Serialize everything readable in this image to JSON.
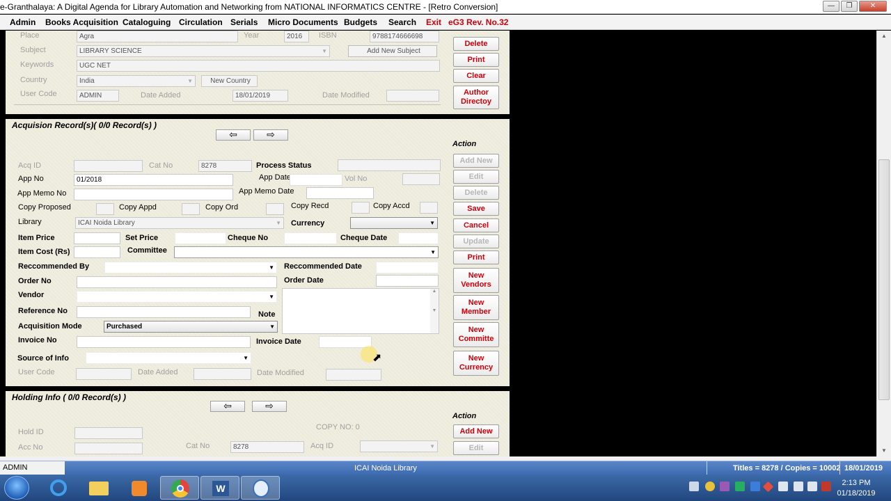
{
  "window": {
    "title": "e-Granthalaya: A Digital Agenda for Library Automation and Networking from NATIONAL INFORMATICS CENTRE - [Retro Conversion]"
  },
  "menu": [
    "Admin",
    "Books Acquisition",
    "Cataloguing",
    "Circulation",
    "Serials",
    "Micro Documents",
    "Budgets",
    "Search",
    "Exit"
  ],
  "menu_version": "eG3 Rev. No.32",
  "top": {
    "place_label": "Place",
    "place_value": "Agra",
    "year_label": "Year",
    "year_value": "2016",
    "isbn_label": "ISBN",
    "isbn_value": "9788174666698",
    "subject_label": "Subject",
    "subject_value": "LIBRARY SCIENCE",
    "add_subject_label": "Add New Subject",
    "keywords_label": "Keywords",
    "keywords_value": "UGC NET",
    "country_label": "Country",
    "country_value": "India",
    "new_country_label": "New Country",
    "user_code_label": "User Code",
    "user_code_value": "ADMIN",
    "date_added_label": "Date Added",
    "date_added_value": "18/01/2019",
    "date_modified_label": "Date Modified",
    "buttons": {
      "delete": "Delete",
      "print": "Print",
      "clear": "Clear",
      "author_line1": "Author",
      "author_line2": "Directoy"
    }
  },
  "acq": {
    "header": "Acquision Record(s)( 0/0 Record(s) )",
    "action_label": "Action",
    "acq_id_label": "Acq ID",
    "cat_no_label": "Cat No",
    "cat_no_value": "8278",
    "process_status_label": "Process Status",
    "app_no_label": "App No",
    "app_no_value": "01/2018",
    "app_date_label": "App Date",
    "vol_no_label": "Vol No",
    "app_memo_no_label": "App Memo No",
    "app_memo_date_label": "App Memo Date",
    "copy_proposed_label": "Copy Proposed",
    "copy_appd_label": "Copy Appd",
    "copy_ord_label": "Copy Ord",
    "copy_recd_label": "Copy Recd",
    "copy_accd_label": "Copy Accd",
    "library_label": "Library",
    "library_value": "ICAI Noida Library",
    "currency_label": "Currency",
    "item_price_label": "Item Price",
    "set_price_label": "Set Price",
    "cheque_no_label": "Cheque No",
    "cheque_date_label": "Cheque Date",
    "item_cost_label": "Item Cost (Rs)",
    "committee_label": "Committee",
    "recommended_by_label": "Reccommended By",
    "recommended_date_label": "Reccommended Date",
    "order_no_label": "Order No",
    "order_date_label": "Order Date",
    "vendor_label": "Vendor",
    "reference_no_label": "Reference No",
    "note_label": "Note",
    "acq_mode_label": "Acquisition Mode",
    "acq_mode_value": "Purchased",
    "invoice_no_label": "Invoice No",
    "invoice_date_label": "Invoice Date",
    "source_label": "Source of Info",
    "user_code_label": "User Code",
    "date_added_label": "Date Added",
    "date_modified_label": "Date Modified",
    "buttons": {
      "add_new": "Add New",
      "edit": "Edit",
      "delete": "Delete",
      "save": "Save",
      "cancel": "Cancel",
      "update": "Update",
      "print": "Print",
      "new_vendors_1": "New",
      "new_vendors_2": "Vendors",
      "new_member_1": "New",
      "new_member_2": "Member",
      "new_committe_1": "New",
      "new_committe_2": "Committe",
      "new_currency_1": "New",
      "new_currency_2": "Currency"
    }
  },
  "holding": {
    "header": "Holding Info ( 0/0 Record(s) )",
    "action_label": "Action",
    "copy_no_label": "COPY NO: 0",
    "hold_id_label": "Hold ID",
    "acc_no_label": "Acc No",
    "cat_no_label": "Cat No",
    "cat_no_value": "8278",
    "acq_id_label": "Acq ID",
    "buttons": {
      "add_new": "Add New",
      "edit": "Edit"
    }
  },
  "status": {
    "user": "ADMIN",
    "library": "ICAI Noida Library",
    "counts": "Titles = 8278 / Copies = 10002",
    "date": "18/01/2019"
  },
  "taskbar": {
    "time": "2:13 PM",
    "date": "01/18/2019",
    "apps": [
      "internet-explorer",
      "file-explorer",
      "media-player",
      "chrome",
      "word",
      "e-granthalaya"
    ]
  },
  "colors": {
    "accent_red": "#d0000b",
    "panel_bg": "#f0eedf",
    "status_blue": "#4a77bd"
  }
}
